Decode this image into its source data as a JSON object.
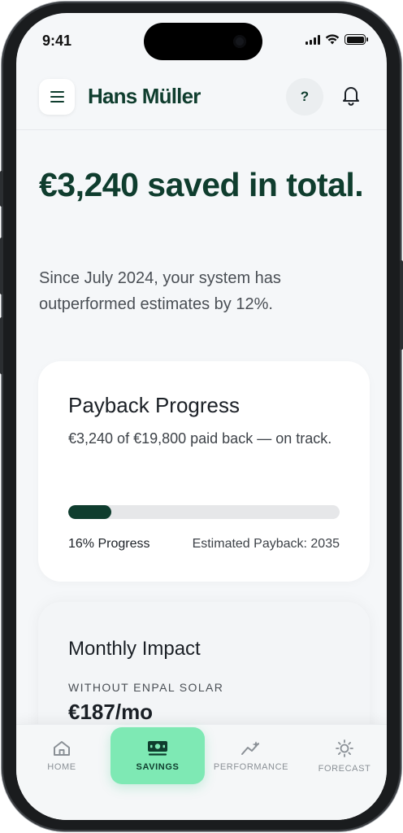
{
  "status_bar": {
    "time": "9:41"
  },
  "header": {
    "menu_icon": "menu-icon",
    "title": "Hans Müller",
    "help_label": "?",
    "bell_icon": "bell-icon"
  },
  "hero": {
    "title": "€3,240 saved in total.",
    "subtitle": "Since July 2024, your system has outperformed estimates by 12%."
  },
  "payback": {
    "title": "Payback Progress",
    "description": "€3,240 of €19,800 paid back — on track.",
    "progress_fraction": 0.16,
    "progress_label": "16% Progress",
    "estimate": "Estimated Payback: 2035"
  },
  "monthly": {
    "title": "Monthly Impact",
    "caption": "WITHOUT ENPAL SOLAR",
    "value": "€187/mo"
  },
  "nav": {
    "items": [
      {
        "label": "HOME",
        "icon": "home-icon",
        "active": false
      },
      {
        "label": "SAVINGS",
        "icon": "banknote-icon",
        "active": true
      },
      {
        "label": "PERFORMANCE",
        "icon": "trend-chart-icon",
        "active": false
      },
      {
        "label": "FORECAST",
        "icon": "sun-icon",
        "active": false
      }
    ]
  },
  "colors": {
    "brand": "#0f3d2e",
    "accent": "#7ee9b4",
    "background": "#f5f7f9"
  }
}
